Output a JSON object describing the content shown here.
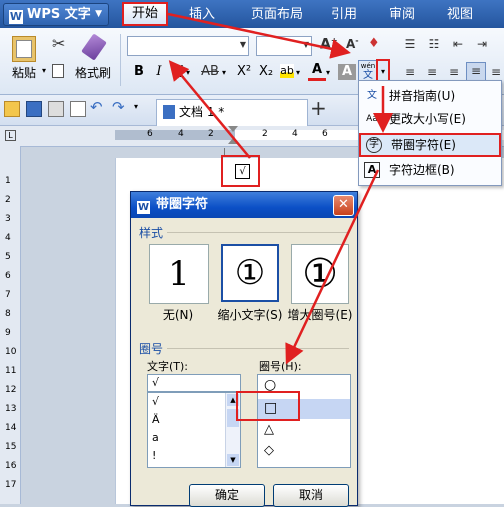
{
  "app": {
    "title": "WPS 文字"
  },
  "menu_tabs": [
    {
      "label": "开始"
    },
    {
      "label": "插入"
    },
    {
      "label": "页面布局"
    },
    {
      "label": "引用"
    },
    {
      "label": "审阅"
    },
    {
      "label": "视图"
    }
  ],
  "ribbon": {
    "paste_label": "粘贴",
    "format_painter_label": "格式刷",
    "cut_icon": "✂",
    "bold": "B",
    "italic": "I",
    "underline": "U",
    "strike": "AB",
    "superscript": "X²",
    "subscript": "X₂",
    "font_color": "A",
    "char_shade": "A",
    "phonetic": "wén"
  },
  "dropdown": {
    "items": [
      {
        "label": "拼音指南(U)",
        "icon": "文"
      },
      {
        "label": "更改大小写(E)",
        "icon": "Aa"
      },
      {
        "label": "带圈字符(E)",
        "icon": "字"
      },
      {
        "label": "字符边框(B)",
        "icon": "A"
      }
    ]
  },
  "doc_tab": {
    "title": "文档 1 *"
  },
  "ruler_numbers": [
    "6",
    "4",
    "2",
    "2",
    "4",
    "6"
  ],
  "vruler_numbers": [
    "1",
    "2",
    "3",
    "4",
    "5",
    "6",
    "7",
    "8",
    "9",
    "10",
    "11",
    "12",
    "13",
    "14",
    "15",
    "16",
    "17"
  ],
  "page_glyph": "√",
  "dialog": {
    "title": "带圈字符",
    "style_group": "样式",
    "styles": [
      {
        "label": "无(N)",
        "glyph": "1"
      },
      {
        "label": "缩小文字(S)",
        "glyph": "①"
      },
      {
        "label": "增大圈号(E)",
        "glyph": "①"
      }
    ],
    "enclose_group": "圈号",
    "text_label": "文字(T):",
    "text_value": "√",
    "text_items": [
      "√",
      "Ä",
      "a",
      "!"
    ],
    "shape_label": "圈号(H):",
    "shapes": [
      "○",
      "□",
      "△",
      "◇"
    ],
    "ok": "确定",
    "cancel": "取消"
  },
  "colors": {
    "highlight": "#e02020",
    "accent": "#2a5eab"
  }
}
